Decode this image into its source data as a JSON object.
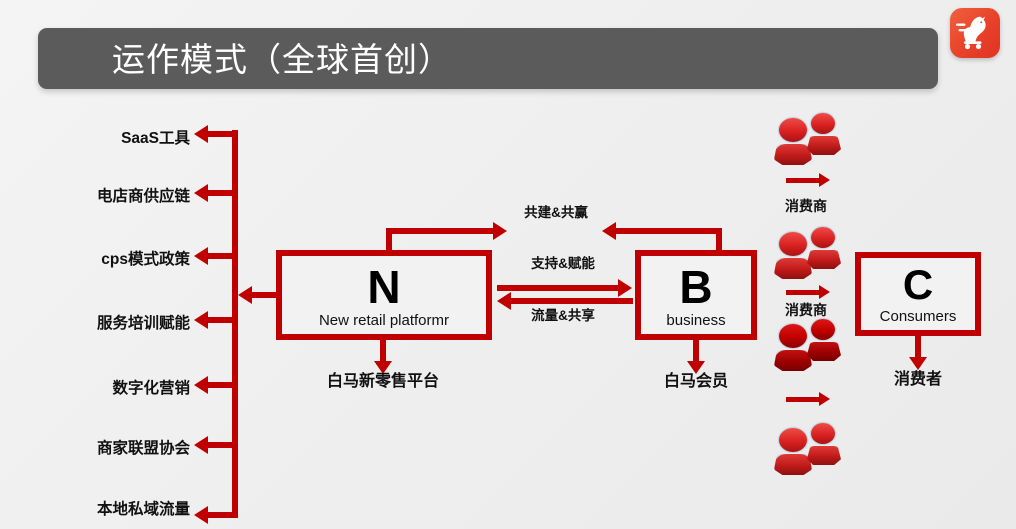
{
  "header": {
    "title": "运作模式（全球首创）",
    "bar_color": "#5b5b5b",
    "text_color": "#ffffff"
  },
  "logo": {
    "name": "white-horse-cart-logo",
    "color": "#e8412a"
  },
  "theme": {
    "accent_red": "#c00000",
    "background": "#f1f1f1"
  },
  "sidebar": {
    "items": [
      {
        "label": "SaaS工具"
      },
      {
        "label": "电店商供应链"
      },
      {
        "label": "cps模式政策"
      },
      {
        "label": "服务培训赋能"
      },
      {
        "label": "数字化营销"
      },
      {
        "label": "商家联盟协会"
      },
      {
        "label": "本地私域流量"
      }
    ]
  },
  "nodes": [
    {
      "id": "n",
      "letter": "N",
      "subtitle": "New retail platformr",
      "caption": "白马新零售平台"
    },
    {
      "id": "b",
      "letter": "B",
      "subtitle": "business",
      "caption": "白马会员"
    },
    {
      "id": "c",
      "letter": "C",
      "subtitle": "Consumers",
      "caption": "消费者"
    }
  ],
  "connectors": [
    {
      "id": "top",
      "label": "共建&共赢"
    },
    {
      "id": "middle",
      "label": "支持&赋能"
    },
    {
      "id": "bottom",
      "label": "流量&共享"
    }
  ],
  "flow": {
    "labels": [
      {
        "label": "消费商"
      },
      {
        "label": "消费商"
      }
    ]
  }
}
